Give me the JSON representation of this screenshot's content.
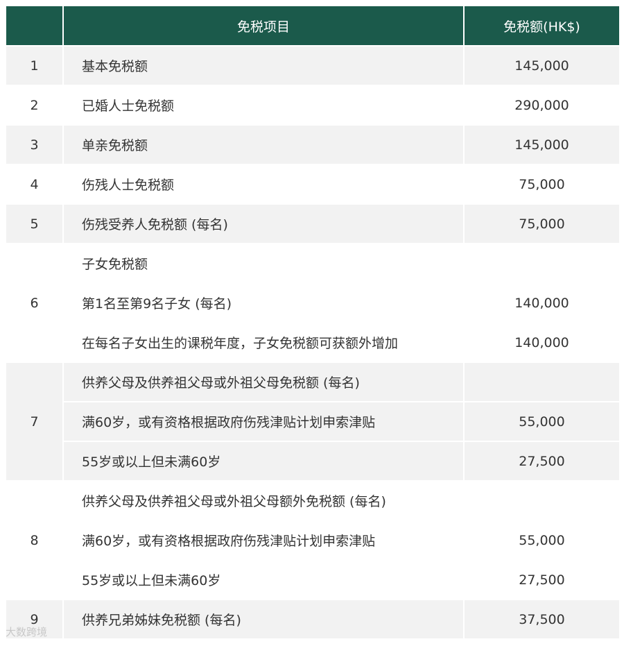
{
  "table": {
    "header": {
      "item": "免税项目",
      "amount": "免税额(HK$)"
    },
    "rows": [
      {
        "no": "1",
        "item": "基本免税额",
        "amount": "145,000"
      },
      {
        "no": "2",
        "item": "已婚人士免税额",
        "amount": "290,000"
      },
      {
        "no": "3",
        "item": "单亲免税额",
        "amount": "145,000"
      },
      {
        "no": "4",
        "item": "伤残人士免税额",
        "amount": "75,000"
      },
      {
        "no": "5",
        "item": "伤残受养人免税额 (每名)",
        "amount": "75,000"
      },
      {
        "no": "6",
        "title": "子女免税额",
        "sub": [
          {
            "item": "第1名至第9名子女 (每名)",
            "amount": "140,000"
          },
          {
            "item": "在每名子女出生的课税年度，子女免税额可获额外增加",
            "amount": "140,000"
          }
        ]
      },
      {
        "no": "7",
        "title": "供养父母及供养祖父母或外祖父母免税额 (每名)",
        "sub": [
          {
            "item": "满60岁，或有资格根据政府伤残津贴计划申索津贴",
            "amount": "55,000"
          },
          {
            "item": "55岁或以上但未满60岁",
            "amount": "27,500"
          }
        ]
      },
      {
        "no": "8",
        "title": "供养父母及供养祖父母或外祖父母额外免税额 (每名)",
        "sub": [
          {
            "item": "满60岁，或有资格根据政府伤残津贴计划申索津贴",
            "amount": "55,000"
          },
          {
            "item": "55岁或以上但未满60岁",
            "amount": "27,500"
          }
        ]
      },
      {
        "no": "9",
        "item": "供养兄弟姊妹免税额 (每名)",
        "amount": "37,500"
      }
    ]
  },
  "watermark": "大数跨境"
}
